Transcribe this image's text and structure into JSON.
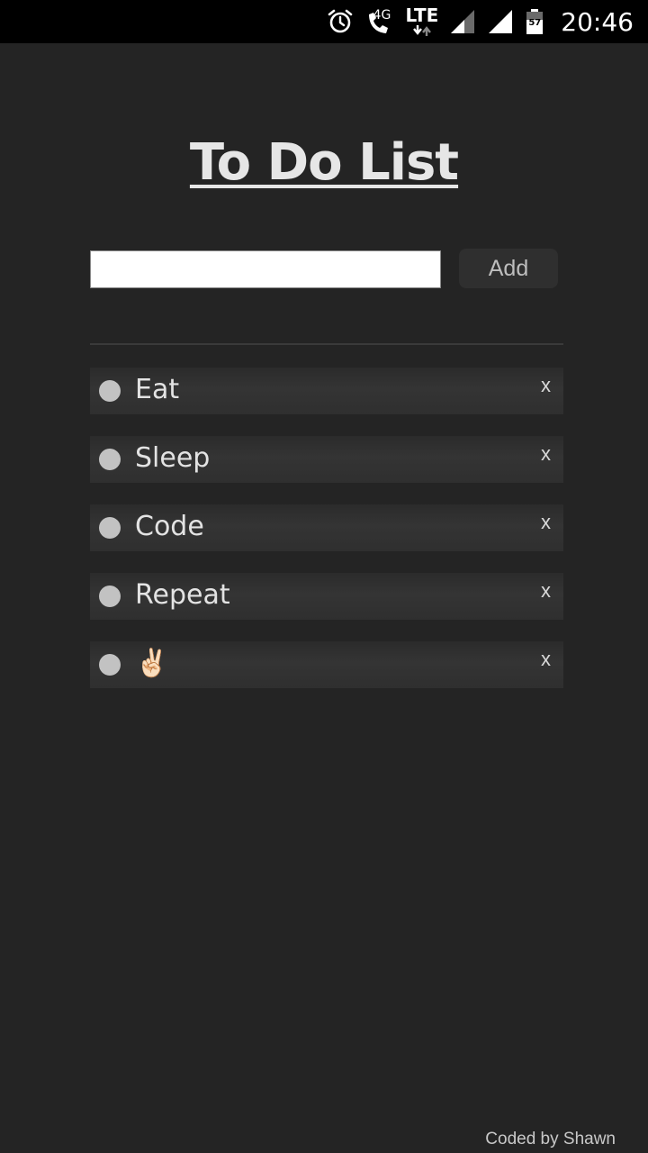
{
  "status_bar": {
    "network_4g": "4G",
    "network_lte": "LTE",
    "battery_level": "57",
    "clock": "20:46",
    "icons": [
      "alarm-icon",
      "volte-call-icon",
      "lte-data-icon",
      "signal-icon",
      "signal-icon",
      "battery-icon"
    ]
  },
  "header": {
    "title": "To Do List"
  },
  "new_task": {
    "value": "",
    "add_label": "Add"
  },
  "tasks": [
    {
      "text": "Eat",
      "delete_label": "x"
    },
    {
      "text": "Sleep",
      "delete_label": "x"
    },
    {
      "text": "Code",
      "delete_label": "x"
    },
    {
      "text": "Repeat",
      "delete_label": "x"
    },
    {
      "text": "✌🏻",
      "delete_label": "x"
    }
  ],
  "footer": {
    "credit": "Coded by Shawn"
  },
  "colors": {
    "background": "#242424",
    "item_background": "#323232",
    "bullet": "#c2c2c2",
    "text": "#e3e3e3"
  }
}
